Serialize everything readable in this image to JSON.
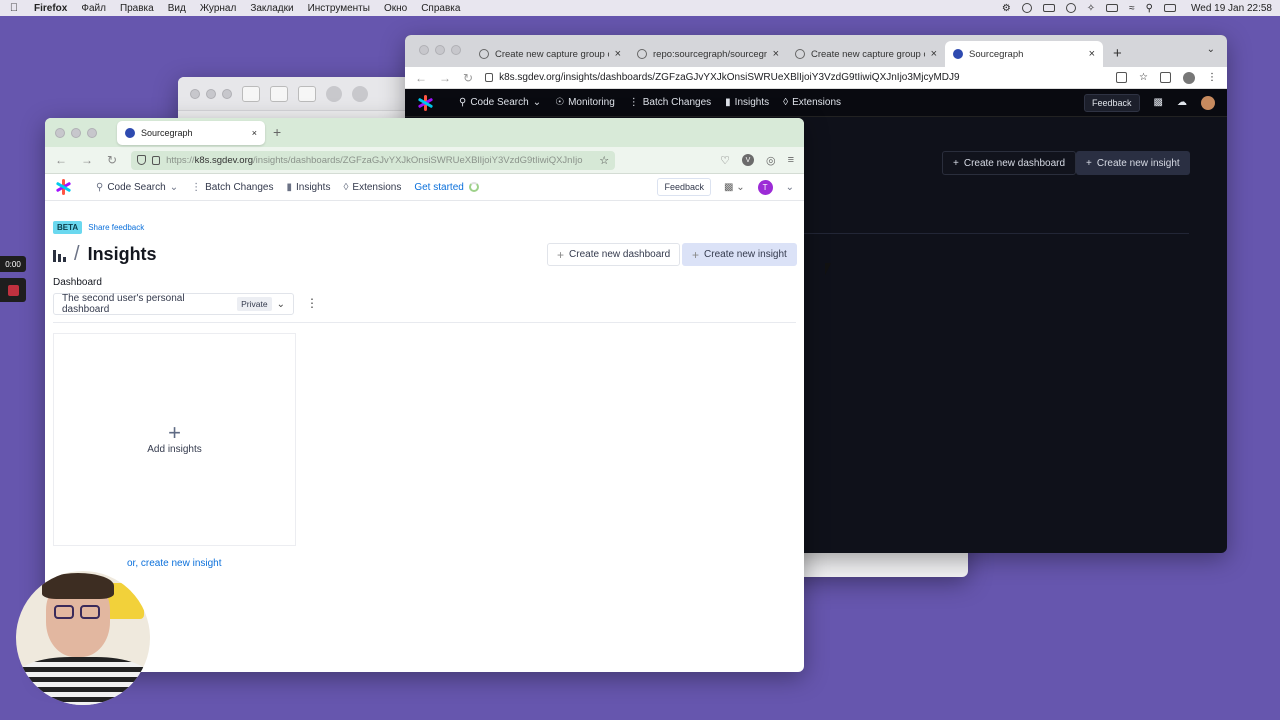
{
  "menubar": {
    "app": "Firefox",
    "items": [
      "Файл",
      "Правка",
      "Вид",
      "Журнал",
      "Закладки",
      "Инструменты",
      "Окно",
      "Справка"
    ],
    "clock": "Wed 19 Jan  22:58"
  },
  "dark_window": {
    "tabs": [
      {
        "title": "Create new capture group code"
      },
      {
        "title": "repo:sourcegraph/sourcegraph"
      },
      {
        "title": "Create new capture group code"
      },
      {
        "title": "Sourcegraph"
      }
    ],
    "url": "k8s.sgdev.org/insights/dashboards/ZGFzaGJvYXJkOnsiSWRUeXBlIjoiY3VzdG9tIiwiQXJnIjo3MjcyMDJ9",
    "nav": {
      "code_search": "Code Search",
      "monitoring": "Monitoring",
      "batch_changes": "Batch Changes",
      "insights": "Insights",
      "extensions": "Extensions",
      "feedback": "Feedback"
    },
    "create_dashboard": "Create new dashboard",
    "create_insight": "Create new insight"
  },
  "front_window": {
    "tab_title": "Sourcegraph",
    "url_prefix": "https://",
    "url_domain": "k8s.sgdev.org",
    "url_path": "/insights/dashboards/ZGFzaGJvYXJkOnsiSWRUeXBlIjoiY3VzdG9tIiwiQXJnIjo",
    "nav": {
      "code_search": "Code Search",
      "batch_changes": "Batch Changes",
      "insights": "Insights",
      "extensions": "Extensions",
      "get_started": "Get started",
      "feedback": "Feedback",
      "user_initial": "T"
    },
    "beta": "BETA",
    "share_feedback": "Share feedback",
    "page_title": "Insights",
    "create_dashboard": "Create new dashboard",
    "create_insight": "Create new insight",
    "dashboard_label": "Dashboard",
    "dashboard_selected": "The second user's personal dashboard",
    "dashboard_badge": "Private",
    "add_insights": "Add insights",
    "or_create": "or, create new insight"
  },
  "recorder": {
    "time": "0:00"
  },
  "colors": {
    "desktop": "#6656ae",
    "accent_blue": "#0b70db",
    "beta_badge": "#6ad8ef",
    "logo": [
      "#ff5543",
      "#a112ff",
      "#00cbec"
    ]
  }
}
